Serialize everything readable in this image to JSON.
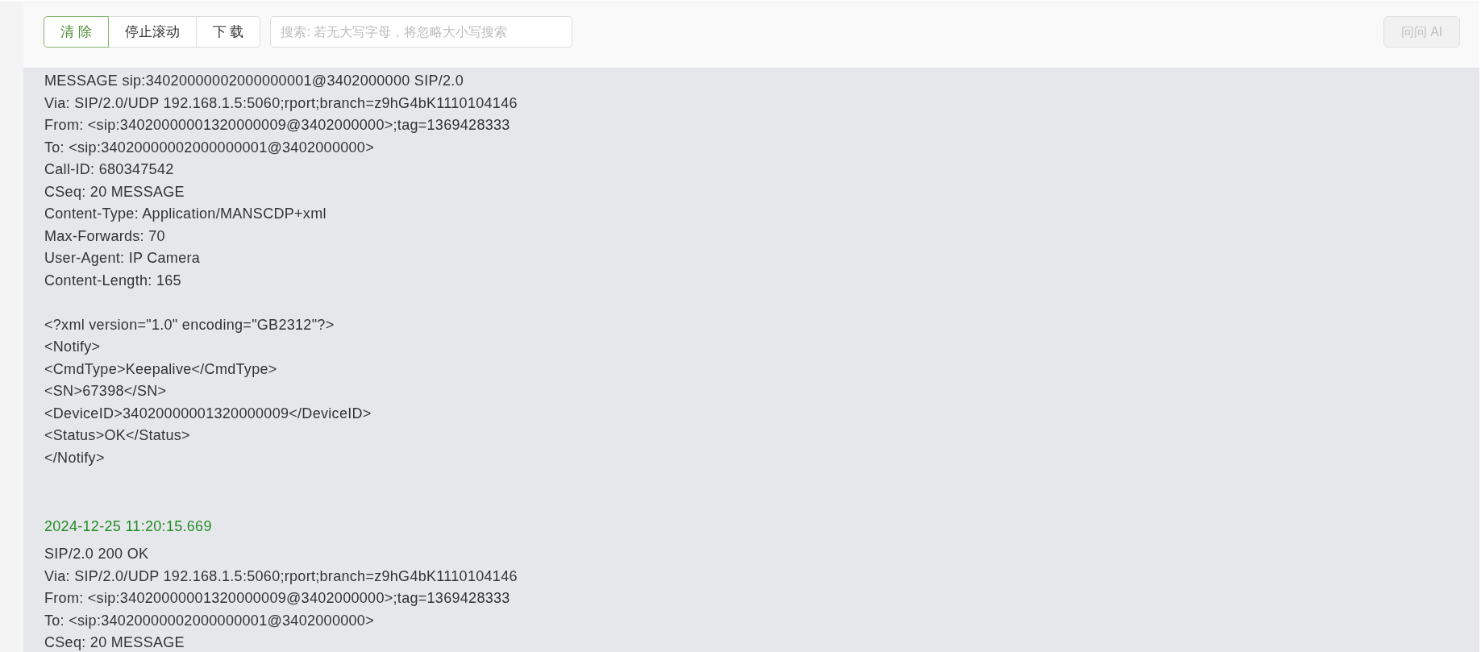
{
  "toolbar": {
    "buttons": [
      {
        "label": "清 除",
        "highlighted": true
      },
      {
        "label": "停止滚动",
        "highlighted": false
      },
      {
        "label": "下 载",
        "highlighted": false
      }
    ],
    "search": {
      "placeholder": "搜索: 若无大写字母，将忽略大小写搜索"
    },
    "ask_ai_button": {
      "label": "问问 AI",
      "disabled": true
    }
  },
  "log": {
    "entries": [
      {
        "headers": [
          "MESSAGE sip:34020000002000000001@3402000000 SIP/2.0",
          "Via: SIP/2.0/UDP 192.168.1.5:5060;rport;branch=z9hG4bK1110104146",
          "From: <sip:34020000001320000009@3402000000>;tag=1369428333",
          "To: <sip:34020000002000000001@3402000000>",
          "Call-ID: 680347542",
          "CSeq: 20 MESSAGE",
          "Content-Type: Application/MANSCDP+xml",
          "Max-Forwards: 70",
          "User-Agent: IP Camera",
          "Content-Length: 165"
        ],
        "body": [
          "<?xml version=\"1.0\" encoding=\"GB2312\"?>",
          "<Notify>",
          "<CmdType>Keepalive</CmdType>",
          "<SN>67398</SN>",
          "<DeviceID>34020000001320000009</DeviceID>",
          "<Status>OK</Status>",
          "</Notify>"
        ]
      },
      {
        "timestamp": "2024-12-25 11:20:15.669",
        "headers": [
          "SIP/2.0 200 OK",
          "Via: SIP/2.0/UDP 192.168.1.5:5060;rport;branch=z9hG4bK1110104146",
          "From: <sip:34020000001320000009@3402000000>;tag=1369428333",
          "To: <sip:34020000002000000001@3402000000>",
          "CSeq: 20 MESSAGE"
        ]
      }
    ]
  }
}
